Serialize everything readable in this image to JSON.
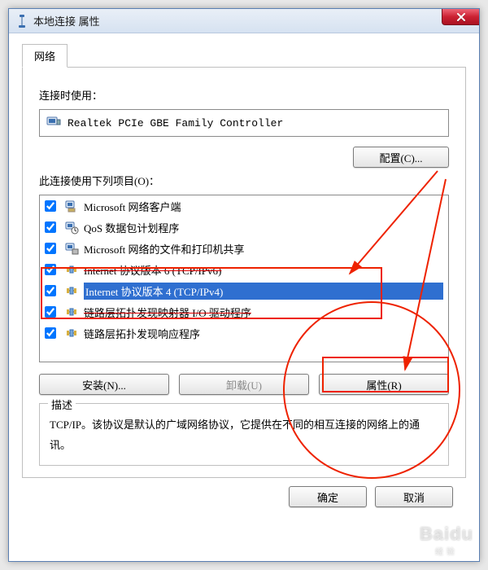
{
  "window": {
    "title": "本地连接 属性",
    "close_x": "×"
  },
  "tabs": {
    "network": "网络"
  },
  "adapter": {
    "label": "连接时使用：",
    "name": "Realtek PCIe GBE Family Controller"
  },
  "configure_btn": "配置(C)...",
  "items_label": "此连接使用下列项目(O)：",
  "items": [
    {
      "label": "Microsoft 网络客户端",
      "checked": true,
      "icon": "client-icon"
    },
    {
      "label": "QoS 数据包计划程序",
      "checked": true,
      "icon": "qos-icon"
    },
    {
      "label": "Microsoft 网络的文件和打印机共享",
      "checked": true,
      "icon": "fileshare-icon"
    },
    {
      "label": "Internet 协议版本 6 (TCP/IPv6)",
      "checked": true,
      "icon": "protocol-icon",
      "struck": true
    },
    {
      "label": "Internet 协议版本 4 (TCP/IPv4)",
      "checked": true,
      "icon": "protocol-icon",
      "selected": true
    },
    {
      "label": "链路层拓扑发现映射器 I/O 驱动程序",
      "checked": true,
      "icon": "protocol-icon",
      "struck": true
    },
    {
      "label": "链路层拓扑发现响应程序",
      "checked": true,
      "icon": "protocol-icon"
    }
  ],
  "buttons": {
    "install": "安装(N)...",
    "uninstall": "卸载(U)",
    "properties": "属性(R)"
  },
  "desc": {
    "legend": "描述",
    "text": "TCP/IP。该协议是默认的广域网络协议，它提供在不同的相互连接的网络上的通讯。"
  },
  "footer": {
    "ok": "确定",
    "cancel": "取消"
  },
  "watermark": {
    "brand": "Baidu",
    "sub": "经验"
  }
}
